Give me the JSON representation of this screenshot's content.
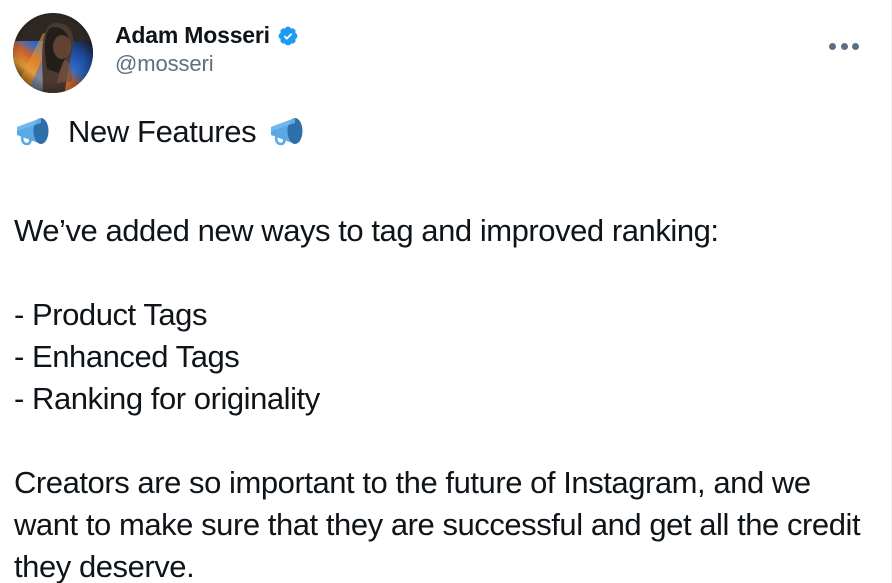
{
  "tweet": {
    "author": {
      "display_name": "Adam Mosseri",
      "handle": "@mosseri",
      "verified": true,
      "verified_badge_color": "#1d9bf0",
      "avatar_alt": "profile-photo-man-with-rainbow-prism-light"
    },
    "more_menu_icon": "more-horizontal-icon",
    "headline": {
      "left_emoji": "megaphone-emoji",
      "text": "New Features",
      "right_emoji": "megaphone-emoji",
      "emoji_color": "#4a9ae0"
    },
    "intro_paragraph": "We’ve added new ways to tag and improved ranking:",
    "features": [
      "- Product Tags",
      "- Enhanced Tags",
      "- Ranking for originality"
    ],
    "closing_paragraph": "Creators are so important to the future of Instagram, and we want to make sure that they are successful and get all the credit they deserve.",
    "colors": {
      "text": "#0f1419",
      "muted_text": "#5b7083",
      "background": "#ffffff",
      "accent": "#1d9bf0"
    }
  }
}
